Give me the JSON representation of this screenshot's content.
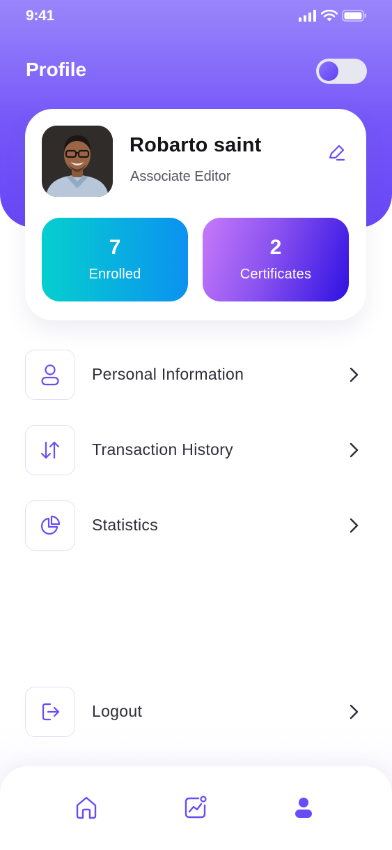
{
  "status_bar": {
    "time": "9:41",
    "icons": [
      "signal-icon",
      "wifi-icon",
      "battery-icon"
    ]
  },
  "header": {
    "title": "Profile",
    "theme_toggle": {
      "on": false
    }
  },
  "profile": {
    "name": "Robarto saint",
    "role": "Associate Editor",
    "stats": [
      {
        "value": "7",
        "label": "Enrolled"
      },
      {
        "value": "2",
        "label": "Certificates"
      }
    ]
  },
  "menu": {
    "items": [
      {
        "label": "Personal Information",
        "icon": "user-icon"
      },
      {
        "label": "Transaction History",
        "icon": "transfer-arrows-icon"
      },
      {
        "label": "Statistics",
        "icon": "pie-chart-icon"
      }
    ],
    "logout": {
      "label": "Logout",
      "icon": "logout-icon"
    }
  },
  "tab_bar": {
    "tabs": [
      {
        "name": "home",
        "icon": "home-icon",
        "active": false
      },
      {
        "name": "activity",
        "icon": "chart-icon",
        "active": false
      },
      {
        "name": "profile",
        "icon": "profile-icon",
        "active": true
      }
    ]
  },
  "colors": {
    "accent": "#6a4cf6",
    "header_gradient_top": "#9a86fb",
    "header_gradient_bottom": "#6747f6",
    "enrolled_gradient": [
      "#06cfcf",
      "#0b92f0"
    ],
    "certificates_gradient": [
      "#c77af9",
      "#2f11e2"
    ],
    "text_primary": "#14131a",
    "text_secondary": "#55535f"
  }
}
